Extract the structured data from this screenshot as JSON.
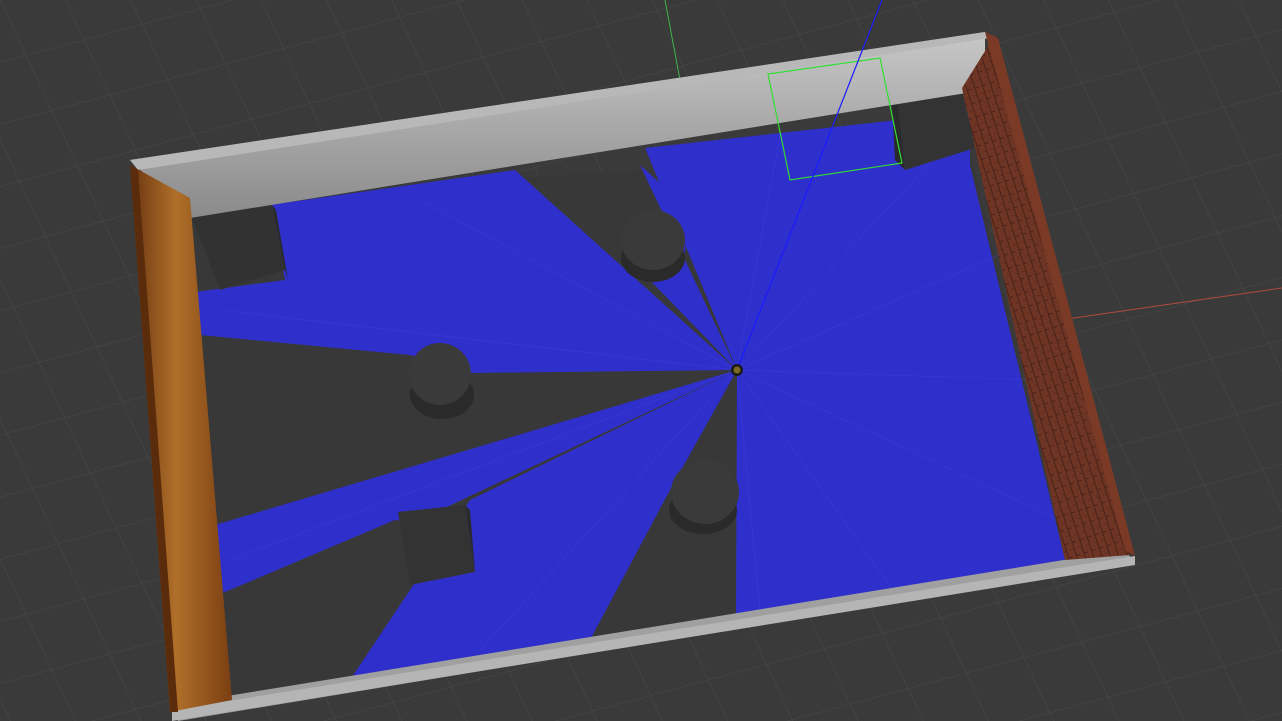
{
  "viewport": {
    "background_color": "#3a3a3a",
    "grid_color": "#4a4a4a"
  },
  "axes": {
    "x_color": "#b34a3e",
    "y_color": "#3fb54a",
    "z_color": "#1a1aff"
  },
  "scene": {
    "floor_color": "#383838",
    "obstacle_color": "#3c3c3c",
    "wall_gray_color": "#9a9a9a",
    "wall_wood_color": "#8b4a16",
    "wall_brick_color": "#6a3522",
    "laser_color": "#2b2be0",
    "selection_box_color": "#33dd33",
    "robot_color": "#6b5a1a"
  }
}
